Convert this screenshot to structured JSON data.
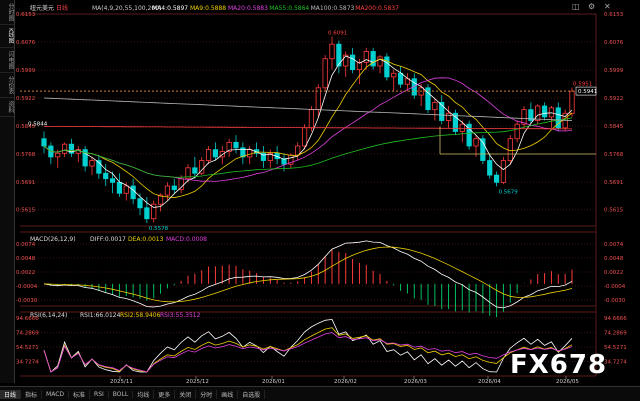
{
  "sidebar": {
    "items": [
      "分时图",
      "K线图",
      "闪电图",
      "分价表",
      "资料"
    ]
  },
  "header": {
    "title": "纽元美元",
    "period": "日线",
    "ma_params": "MA(4,9,20,55,100,200)",
    "ma_values": [
      {
        "label": "MA4:0.5897",
        "color": "#ffffff"
      },
      {
        "label": "MA9:0.5888",
        "color": "#f0d000"
      },
      {
        "label": "MA20:0.5883",
        "color": "#e040e0"
      },
      {
        "label": "MA55:0.5864",
        "color": "#20c020"
      },
      {
        "label": "MA100:0.5873",
        "color": "#bbbbbb"
      },
      {
        "label": "MA200:0.5837",
        "color": "#ff4040"
      }
    ]
  },
  "top_icons": [
    "◫",
    "⚙",
    "✕"
  ],
  "price_axis": {
    "left": [
      "0.6153",
      "0.6076",
      "0.5999",
      "0.5922",
      "0.5845",
      "0.5768",
      "0.5691",
      "0.5615"
    ],
    "right": [
      "0.6153",
      "0.6076",
      "0.5999",
      "0.5922",
      "0.5845",
      "0.5768",
      "0.5691",
      "0.5615"
    ],
    "current": "0.5941"
  },
  "annotations": {
    "high": "0.6091",
    "low1": "0.5578",
    "low2": "0.5679",
    "left_mark": "0.5844",
    "last_high": "0.5951"
  },
  "macd": {
    "label": "MACD(26,12,9)",
    "diff": "DIFF:0.0017",
    "dea": "DEA:0.0013",
    "macd": "MACD:0.0008",
    "axis": [
      "0.0074",
      "0.0048",
      "0.0022",
      "-0.0004",
      "-0.0030"
    ]
  },
  "rsi": {
    "label": "RSI(6,14,24)",
    "rsi1": "RSI1:66.0124",
    "rsi2": "RSI2:58.9406",
    "rsi3": "RSI3:55.3512",
    "axis": [
      "94.6666",
      "74.2869",
      "54.5271",
      "34.7274"
    ]
  },
  "x_axis": [
    "2025/11",
    "2025/12",
    "2026/01",
    "2026/02",
    "2026/03",
    "2026/04",
    "2026/05"
  ],
  "bottom_tabs": [
    "日线",
    "指标",
    "MACD",
    "标准",
    "RSI",
    "BOLL",
    "均线",
    "更多",
    "关闭",
    "分时",
    "画线",
    "自选股"
  ],
  "watermark": "FX678",
  "colors": {
    "up": "#ff3b3b",
    "down": "#00d0d0",
    "bg": "#000000",
    "grid": "#5a2020"
  },
  "chart_data": {
    "type": "candlestick",
    "ylim": [
      0.557,
      0.6153
    ],
    "candles": [
      [
        0.581,
        0.583,
        0.577,
        0.579
      ],
      [
        0.579,
        0.58,
        0.574,
        0.576
      ],
      [
        0.576,
        0.578,
        0.573,
        0.577
      ],
      [
        0.577,
        0.58,
        0.576,
        0.5795
      ],
      [
        0.5795,
        0.581,
        0.576,
        0.577
      ],
      [
        0.577,
        0.579,
        0.5745,
        0.578
      ],
      [
        0.578,
        0.579,
        0.572,
        0.5735
      ],
      [
        0.5735,
        0.576,
        0.571,
        0.575
      ],
      [
        0.575,
        0.5765,
        0.57,
        0.5715
      ],
      [
        0.5715,
        0.574,
        0.568,
        0.57
      ],
      [
        0.57,
        0.572,
        0.566,
        0.569
      ],
      [
        0.569,
        0.5715,
        0.565,
        0.566
      ],
      [
        0.566,
        0.569,
        0.564,
        0.568
      ],
      [
        0.568,
        0.57,
        0.563,
        0.5645
      ],
      [
        0.5645,
        0.566,
        0.56,
        0.562
      ],
      [
        0.562,
        0.565,
        0.5578,
        0.559
      ],
      [
        0.559,
        0.564,
        0.558,
        0.563
      ],
      [
        0.563,
        0.566,
        0.561,
        0.5655
      ],
      [
        0.5655,
        0.569,
        0.564,
        0.568
      ],
      [
        0.568,
        0.57,
        0.566,
        0.567
      ],
      [
        0.567,
        0.571,
        0.566,
        0.57
      ],
      [
        0.57,
        0.574,
        0.569,
        0.573
      ],
      [
        0.573,
        0.576,
        0.57,
        0.5715
      ],
      [
        0.5715,
        0.576,
        0.571,
        0.575
      ],
      [
        0.575,
        0.579,
        0.574,
        0.578
      ],
      [
        0.578,
        0.58,
        0.575,
        0.576
      ],
      [
        0.576,
        0.579,
        0.574,
        0.5775
      ],
      [
        0.5775,
        0.581,
        0.576,
        0.58
      ],
      [
        0.58,
        0.582,
        0.577,
        0.5785
      ],
      [
        0.5785,
        0.58,
        0.574,
        0.576
      ],
      [
        0.576,
        0.579,
        0.574,
        0.578
      ],
      [
        0.578,
        0.58,
        0.576,
        0.577
      ],
      [
        0.577,
        0.579,
        0.573,
        0.575
      ],
      [
        0.575,
        0.578,
        0.573,
        0.577
      ],
      [
        0.577,
        0.579,
        0.574,
        0.5755
      ],
      [
        0.5755,
        0.577,
        0.572,
        0.574
      ],
      [
        0.574,
        0.577,
        0.573,
        0.5765
      ],
      [
        0.5765,
        0.58,
        0.575,
        0.579
      ],
      [
        0.579,
        0.585,
        0.578,
        0.584
      ],
      [
        0.584,
        0.59,
        0.583,
        0.589
      ],
      [
        0.589,
        0.596,
        0.587,
        0.595
      ],
      [
        0.595,
        0.604,
        0.594,
        0.603
      ],
      [
        0.603,
        0.6091,
        0.6,
        0.607
      ],
      [
        0.607,
        0.608,
        0.599,
        0.601
      ],
      [
        0.601,
        0.605,
        0.598,
        0.604
      ],
      [
        0.604,
        0.606,
        0.599,
        0.6
      ],
      [
        0.6,
        0.603,
        0.596,
        0.602
      ],
      [
        0.602,
        0.606,
        0.6,
        0.605
      ],
      [
        0.605,
        0.606,
        0.6,
        0.601
      ],
      [
        0.601,
        0.604,
        0.599,
        0.6035
      ],
      [
        0.6035,
        0.6045,
        0.597,
        0.598
      ],
      [
        0.598,
        0.6,
        0.594,
        0.599
      ],
      [
        0.599,
        0.601,
        0.595,
        0.596
      ],
      [
        0.596,
        0.599,
        0.594,
        0.5975
      ],
      [
        0.5975,
        0.599,
        0.592,
        0.593
      ],
      [
        0.593,
        0.596,
        0.59,
        0.595
      ],
      [
        0.595,
        0.596,
        0.588,
        0.589
      ],
      [
        0.589,
        0.592,
        0.586,
        0.591
      ],
      [
        0.591,
        0.593,
        0.585,
        0.586
      ],
      [
        0.586,
        0.59,
        0.584,
        0.588
      ],
      [
        0.588,
        0.589,
        0.582,
        0.583
      ],
      [
        0.583,
        0.586,
        0.58,
        0.585
      ],
      [
        0.585,
        0.586,
        0.578,
        0.579
      ],
      [
        0.579,
        0.582,
        0.576,
        0.581
      ],
      [
        0.581,
        0.582,
        0.574,
        0.575
      ],
      [
        0.575,
        0.577,
        0.57,
        0.571
      ],
      [
        0.571,
        0.572,
        0.5679,
        0.569
      ],
      [
        0.569,
        0.576,
        0.5685,
        0.575
      ],
      [
        0.575,
        0.582,
        0.574,
        0.581
      ],
      [
        0.581,
        0.586,
        0.58,
        0.585
      ],
      [
        0.585,
        0.59,
        0.584,
        0.589
      ],
      [
        0.589,
        0.591,
        0.585,
        0.586
      ],
      [
        0.586,
        0.5905,
        0.585,
        0.59
      ],
      [
        0.59,
        0.591,
        0.586,
        0.587
      ],
      [
        0.587,
        0.59,
        0.584,
        0.5895
      ],
      [
        0.5895,
        0.591,
        0.583,
        0.584
      ],
      [
        0.584,
        0.589,
        0.583,
        0.588
      ],
      [
        0.588,
        0.5951,
        0.587,
        0.5941
      ]
    ]
  }
}
